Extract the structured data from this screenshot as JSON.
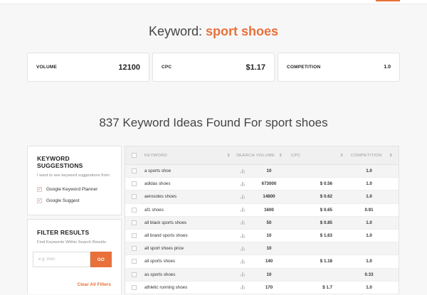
{
  "keyword": {
    "label": "Keyword:",
    "value": "sport shoes"
  },
  "stats": [
    {
      "label": "VOLUME",
      "value": "12100"
    },
    {
      "label": "CPC",
      "value": "$1.17"
    },
    {
      "label": "COMPETITION",
      "value": "1.0"
    }
  ],
  "ideas_title": "837 Keyword Ideas Found For sport shoes",
  "suggestions": {
    "title": "KEYWORD SUGGESTIONS",
    "help": "I want to see keyword suggestions from",
    "options": [
      {
        "label": "Google Keyword Planner",
        "checked": true
      },
      {
        "label": "Google Suggest",
        "checked": true
      }
    ]
  },
  "filter": {
    "title": "FILTER RESULTS",
    "help": "Find Keywords Within Search Results",
    "placeholder": "e.g. men",
    "go_label": "GO",
    "clear_label": "Clear All Filters"
  },
  "table": {
    "headers": [
      "KEYWORD",
      "SEARCH VOLUME",
      "CPC",
      "COMPETITION"
    ],
    "rows": [
      {
        "keyword": "a sports shoe",
        "volume": "10",
        "cpc": "",
        "competition": "1.0"
      },
      {
        "keyword": "adidas shoes",
        "volume": "673000",
        "cpc": "$ 0.56",
        "competition": "1.0"
      },
      {
        "keyword": "aerosoles shoes",
        "volume": "14800",
        "cpc": "$ 0.62",
        "competition": "1.0"
      },
      {
        "keyword": "af1 shoes",
        "volume": "1600",
        "cpc": "$ 0.65",
        "competition": "0.91"
      },
      {
        "keyword": "all black sports shoes",
        "volume": "50",
        "cpc": "$ 0.85",
        "competition": "1.0"
      },
      {
        "keyword": "all brand sports shoes",
        "volume": "10",
        "cpc": "$ 1.63",
        "competition": "1.0"
      },
      {
        "keyword": "all sport shoes price",
        "volume": "10",
        "cpc": "",
        "competition": ""
      },
      {
        "keyword": "all sports shoes",
        "volume": "140",
        "cpc": "$ 1.18",
        "competition": "1.0"
      },
      {
        "keyword": "as sports shoes",
        "volume": "10",
        "cpc": "",
        "competition": "0.33"
      },
      {
        "keyword": "athletic running shoes",
        "volume": "170",
        "cpc": "$ 1.7",
        "competition": "1.0"
      }
    ]
  },
  "colors": {
    "accent": "#e8703a",
    "background": "#f7f7f7"
  },
  "icons": {
    "volume_trend": "bar-chart-icon",
    "sort": "sort-arrows-icon",
    "checkbox": "checkbox-icon"
  }
}
